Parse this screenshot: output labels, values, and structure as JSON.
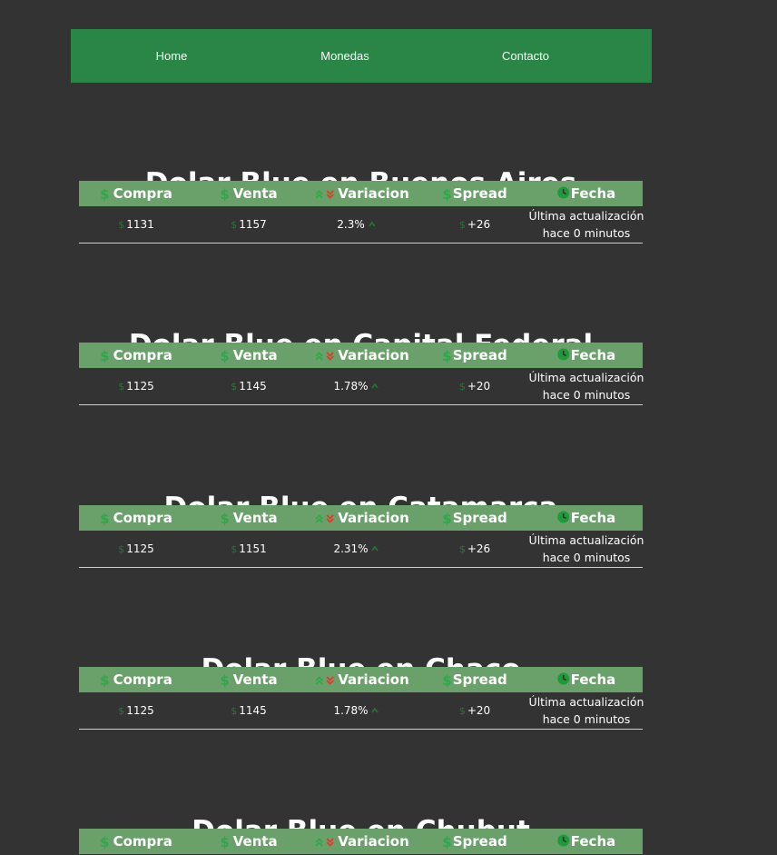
{
  "nav": {
    "items": [
      {
        "label": "Home"
      },
      {
        "label": "Monedas"
      },
      {
        "label": "Contacto"
      }
    ]
  },
  "headers": {
    "compra": "Compra",
    "venta": "Venta",
    "variacion": "Variacion",
    "spread": "Spread",
    "fecha": "Fecha"
  },
  "colors": {
    "navbar": "#2a8646",
    "table_header": "#6aa16a",
    "background": "#333333",
    "icon_green": "#2da84a",
    "icon_red": "#e03a2e"
  },
  "sections": [
    {
      "title": "Dolar Blue en Buenos Aires",
      "compra": "1131",
      "venta": "1157",
      "variacion": "2.3%",
      "spread": "+26",
      "fecha_line1": "Última actualización",
      "fecha_line2": "hace 0 minutos"
    },
    {
      "title": "Dolar Blue en Capital Federal",
      "compra": "1125",
      "venta": "1145",
      "variacion": "1.78%",
      "spread": "+20",
      "fecha_line1": "Última actualización",
      "fecha_line2": "hace 0 minutos"
    },
    {
      "title": "Dolar Blue en Catamarca",
      "compra": "1125",
      "venta": "1151",
      "variacion": "2.31%",
      "spread": "+26",
      "fecha_line1": "Última actualización",
      "fecha_line2": "hace 0 minutos"
    },
    {
      "title": "Dolar Blue en Chaco",
      "compra": "1125",
      "venta": "1145",
      "variacion": "1.78%",
      "spread": "+20",
      "fecha_line1": "Última actualización",
      "fecha_line2": "hace 0 minutos"
    },
    {
      "title": "Dolar Blue en Chubut"
    }
  ]
}
